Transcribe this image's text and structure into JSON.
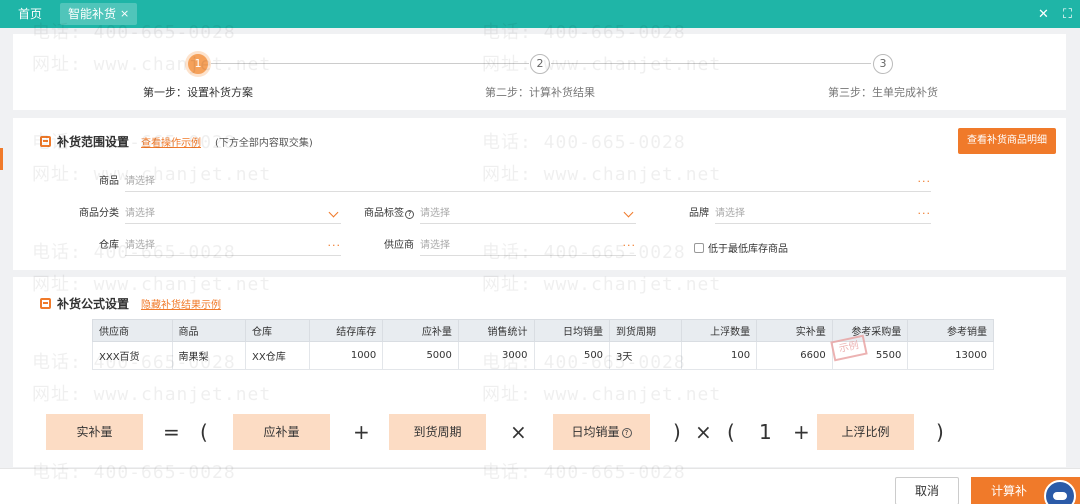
{
  "topbar": {
    "home": "首页",
    "active_tab": "智能补货",
    "close": "×",
    "window_close": "✕",
    "fullscreen": "⛶"
  },
  "steps": [
    {
      "num": "1",
      "label": "第一步：设置补货方案",
      "active": true
    },
    {
      "num": "2",
      "label": "第二步：计算补货结果",
      "active": false
    },
    {
      "num": "3",
      "label": "第三步：生单完成补货",
      "active": false
    }
  ],
  "range": {
    "title": "补货范围设置",
    "link": "查看操作示例",
    "note": "(下方全部内容取交集)",
    "detail_button": "查看补货商品明细",
    "fields": {
      "product": {
        "label": "商品",
        "placeholder": "请选择"
      },
      "category": {
        "label": "商品分类",
        "placeholder": "请选择"
      },
      "tag": {
        "label": "商品标签",
        "placeholder": "请选择"
      },
      "brand": {
        "label": "品牌",
        "placeholder": "请选择"
      },
      "warehouse": {
        "label": "仓库",
        "placeholder": "请选择"
      },
      "supplier": {
        "label": "供应商",
        "placeholder": "请选择"
      }
    },
    "checkbox": "低于最低库存商品",
    "dots": "···",
    "help": "?"
  },
  "formula": {
    "title": "补货公式设置",
    "link": "隐藏补货结果示例",
    "table": {
      "headers": [
        "供应商",
        "商品",
        "仓库",
        "结存库存",
        "应补量",
        "销售统计",
        "日均销量",
        "到货周期",
        "上浮数量",
        "实补量",
        "参考采购量",
        "参考销量"
      ],
      "row": [
        "XXX百货",
        "南果梨",
        "XX仓库",
        "1000",
        "5000",
        "3000",
        "500",
        "3天",
        "100",
        "6600",
        "5500",
        "13000"
      ]
    },
    "stamp": "示例",
    "eq": {
      "actual": "实补量",
      "equals": "=",
      "lparen1": "(",
      "should": "应补量",
      "plus1": "+",
      "cycle": "到货周期",
      "times1": "×",
      "daily": "日均销量",
      "rparen1": ")",
      "times2": "×",
      "lparen2": "(",
      "one": "1",
      "plus2": "+",
      "ratio": "上浮比例",
      "rparen2": ")"
    }
  },
  "footer": {
    "cancel": "取消",
    "calc": "计算补"
  },
  "watermark": {
    "phone": "电话: 400-665-0028",
    "site": "网址: www.chanjet.net"
  }
}
